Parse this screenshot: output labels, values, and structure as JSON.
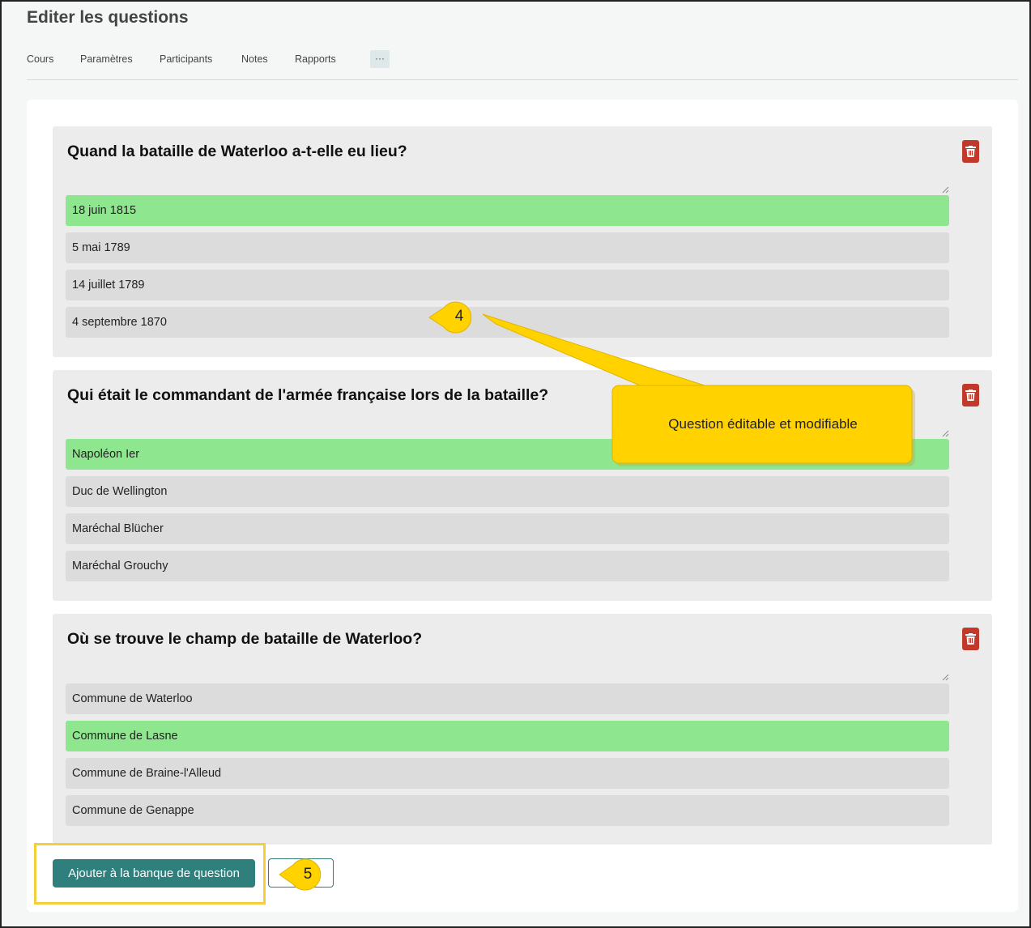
{
  "page": {
    "title": "Editer les questions"
  },
  "nav": {
    "items": [
      {
        "label": "Cours"
      },
      {
        "label": "Paramètres"
      },
      {
        "label": "Participants"
      },
      {
        "label": "Notes"
      },
      {
        "label": "Rapports"
      }
    ],
    "more_label": "···"
  },
  "questions": [
    {
      "title": "Quand la bataille de Waterloo a-t-elle eu lieu?",
      "answers": [
        {
          "text": "18 juin 1815",
          "correct": true
        },
        {
          "text": "5 mai 1789",
          "correct": false
        },
        {
          "text": "14 juillet 1789",
          "correct": false
        },
        {
          "text": "4 septembre 1870",
          "correct": false
        }
      ]
    },
    {
      "title": "Qui était le commandant de l'armée française lors de la bataille?",
      "answers": [
        {
          "text": "Napoléon Ier",
          "correct": true
        },
        {
          "text": "Duc de Wellington",
          "correct": false
        },
        {
          "text": "Maréchal Blücher",
          "correct": false
        },
        {
          "text": "Maréchal Grouchy",
          "correct": false
        }
      ]
    },
    {
      "title": "Où se trouve le champ de bataille de Waterloo?",
      "answers": [
        {
          "text": "Commune de Waterloo",
          "correct": false
        },
        {
          "text": "Commune de Lasne",
          "correct": true
        },
        {
          "text": "Commune de Braine-l'Alleud",
          "correct": false
        },
        {
          "text": "Commune de Genappe",
          "correct": false
        }
      ]
    }
  ],
  "actions": {
    "add_to_bank_label": "Ajouter à la banque de question"
  },
  "annotations": {
    "callout_text": "Question éditable et modifiable",
    "badge_4": "4",
    "badge_5": "5"
  },
  "colors": {
    "correct_answer": "#8ee68e",
    "callout": "#ffd200",
    "primary": "#2f7f7c",
    "delete": "#c0392b"
  },
  "icons": {
    "delete": "trash-icon",
    "resize": "resize-grip-icon"
  }
}
